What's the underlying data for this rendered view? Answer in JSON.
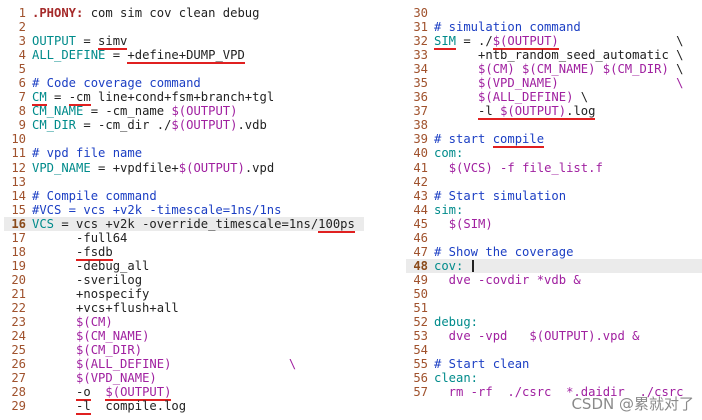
{
  "left_lines": [
    {
      "n": "1",
      "segs": [
        {
          "t": ".PHONY:",
          "c": "c-type"
        },
        {
          "t": " com sim cov clean debug",
          "c": "c-plain"
        }
      ]
    },
    {
      "n": "2",
      "segs": []
    },
    {
      "n": "3",
      "segs": [
        {
          "t": "OUTPUT",
          "c": "c-ident"
        },
        {
          "t": " = ",
          "c": "c-plain"
        },
        {
          "t": "simv",
          "c": "c-plain",
          "u": true
        }
      ]
    },
    {
      "n": "4",
      "segs": [
        {
          "t": "ALL_DEFINE",
          "c": "c-ident"
        },
        {
          "t": " = ",
          "c": "c-plain"
        },
        {
          "t": "+define+DUMP_VPD",
          "c": "c-plain",
          "u": true
        }
      ]
    },
    {
      "n": "5",
      "segs": []
    },
    {
      "n": "6",
      "segs": [
        {
          "t": "# Code coverage command",
          "c": "c-comment"
        }
      ]
    },
    {
      "n": "7",
      "segs": [
        {
          "t": "CM",
          "c": "c-ident",
          "u": true
        },
        {
          "t": " = ",
          "c": "c-plain"
        },
        {
          "t": "-cm",
          "c": "c-plain",
          "u": true
        },
        {
          "t": " line+cond+fsm+branch+tgl",
          "c": "c-plain"
        }
      ]
    },
    {
      "n": "8",
      "segs": [
        {
          "t": "CM_NAME",
          "c": "c-ident"
        },
        {
          "t": " = -cm_name ",
          "c": "c-plain"
        },
        {
          "t": "$(OUTPUT)",
          "c": "c-var"
        }
      ]
    },
    {
      "n": "9",
      "segs": [
        {
          "t": "CM_DIR",
          "c": "c-ident"
        },
        {
          "t": " = -cm_dir ./",
          "c": "c-plain"
        },
        {
          "t": "$(OUTPUT)",
          "c": "c-var"
        },
        {
          "t": ".vdb",
          "c": "c-plain"
        }
      ]
    },
    {
      "n": "10",
      "segs": []
    },
    {
      "n": "11",
      "segs": [
        {
          "t": "# vpd file name",
          "c": "c-comment"
        }
      ]
    },
    {
      "n": "12",
      "segs": [
        {
          "t": "VPD_NAME",
          "c": "c-ident"
        },
        {
          "t": " = +vpdfile+",
          "c": "c-plain"
        },
        {
          "t": "$(OUTPUT)",
          "c": "c-var"
        },
        {
          "t": ".vpd",
          "c": "c-plain"
        }
      ]
    },
    {
      "n": "13",
      "segs": []
    },
    {
      "n": "14",
      "segs": [
        {
          "t": "# Compile command",
          "c": "c-comment"
        }
      ]
    },
    {
      "n": "15",
      "segs": [
        {
          "t": "#VCS = vcs +v2k -timescale=1ns/1ns",
          "c": "c-comment"
        }
      ]
    },
    {
      "n": "16",
      "cur": true,
      "hl": true,
      "segs": [
        {
          "t": "VCS",
          "c": "c-ident"
        },
        {
          "t": " = vcs +v2k -override_timescale=1ns/",
          "c": "c-plain"
        },
        {
          "t": "100ps",
          "c": "c-plain",
          "u": true
        }
      ]
    },
    {
      "n": "17",
      "segs": [
        {
          "t": "      -full64",
          "c": "c-plain"
        }
      ]
    },
    {
      "n": "18",
      "segs": [
        {
          "t": "      ",
          "c": "c-plain"
        },
        {
          "t": "-fsdb",
          "c": "c-plain",
          "u": true
        }
      ]
    },
    {
      "n": "19",
      "segs": [
        {
          "t": "      -debug_all",
          "c": "c-plain"
        }
      ]
    },
    {
      "n": "20",
      "segs": [
        {
          "t": "      -sverilog",
          "c": "c-plain"
        }
      ]
    },
    {
      "n": "21",
      "segs": [
        {
          "t": "      +nospecify",
          "c": "c-plain"
        }
      ]
    },
    {
      "n": "22",
      "segs": [
        {
          "t": "      +vcs+flush+all",
          "c": "c-plain"
        }
      ]
    },
    {
      "n": "23",
      "segs": [
        {
          "t": "      ",
          "c": "c-plain"
        },
        {
          "t": "$(CM)",
          "c": "c-var"
        }
      ]
    },
    {
      "n": "24",
      "segs": [
        {
          "t": "      ",
          "c": "c-plain"
        },
        {
          "t": "$(CM_NAME)",
          "c": "c-var"
        }
      ]
    },
    {
      "n": "25",
      "segs": [
        {
          "t": "      ",
          "c": "c-plain"
        },
        {
          "t": "$(CM_DIR)",
          "c": "c-var"
        }
      ]
    },
    {
      "n": "26",
      "segs": [
        {
          "t": "      ",
          "c": "c-plain"
        },
        {
          "t": "$(ALL_DEFINE)",
          "c": "c-var"
        },
        {
          "t": "                \\",
          "c": "c-var"
        }
      ]
    },
    {
      "n": "27",
      "segs": [
        {
          "t": "      ",
          "c": "c-plain"
        },
        {
          "t": "$(VPD_NAME)",
          "c": "c-var"
        }
      ]
    },
    {
      "n": "28",
      "segs": [
        {
          "t": "      ",
          "c": "c-plain"
        },
        {
          "t": "-o",
          "c": "c-plain",
          "u": true
        },
        {
          "t": "  ",
          "c": "c-plain"
        },
        {
          "t": "$(OUTPUT)",
          "c": "c-var",
          "u": true
        }
      ]
    },
    {
      "n": "29",
      "segs": [
        {
          "t": "      ",
          "c": "c-plain"
        },
        {
          "t": "-l",
          "c": "c-plain",
          "u": true
        },
        {
          "t": "  compile.log",
          "c": "c-plain"
        }
      ]
    }
  ],
  "right_lines": [
    {
      "n": "30",
      "segs": []
    },
    {
      "n": "31",
      "segs": [
        {
          "t": "# simulation command",
          "c": "c-comment"
        }
      ]
    },
    {
      "n": "32",
      "segs": [
        {
          "t": "SIM",
          "c": "c-ident",
          "u": true
        },
        {
          "t": " = ./",
          "c": "c-plain"
        },
        {
          "t": "$(OUTPUT)",
          "c": "c-var",
          "u": true
        },
        {
          "t": "                \\",
          "c": "c-plain"
        }
      ]
    },
    {
      "n": "33",
      "segs": [
        {
          "t": "      +ntb_random_seed_automatic \\",
          "c": "c-plain"
        }
      ]
    },
    {
      "n": "34",
      "segs": [
        {
          "t": "      ",
          "c": "c-plain"
        },
        {
          "t": "$(CM) $(CM_NAME) $(CM_DIR)",
          "c": "c-var"
        },
        {
          "t": " \\",
          "c": "c-plain"
        }
      ]
    },
    {
      "n": "35",
      "segs": [
        {
          "t": "      ",
          "c": "c-plain"
        },
        {
          "t": "$(VPD_NAME)",
          "c": "c-var"
        },
        {
          "t": "                \\",
          "c": "c-var"
        }
      ]
    },
    {
      "n": "36",
      "segs": [
        {
          "t": "      ",
          "c": "c-plain"
        },
        {
          "t": "$(ALL_DEFINE)",
          "c": "c-var"
        },
        {
          "t": " \\",
          "c": "c-plain"
        }
      ]
    },
    {
      "n": "37",
      "segs": [
        {
          "t": "      ",
          "c": "c-plain"
        },
        {
          "t": "-l",
          "c": "c-plain",
          "u": true
        },
        {
          "t": " ",
          "c": "c-plain",
          "u": true
        },
        {
          "t": "$(OUTPUT)",
          "c": "c-var",
          "u": true
        },
        {
          "t": ".log",
          "c": "c-plain",
          "u": true
        }
      ]
    },
    {
      "n": "38",
      "segs": []
    },
    {
      "n": "39",
      "segs": [
        {
          "t": "# start ",
          "c": "c-comment"
        },
        {
          "t": "compile",
          "c": "c-comment",
          "u": true
        }
      ]
    },
    {
      "n": "40",
      "segs": [
        {
          "t": "com:",
          "c": "c-ident"
        }
      ]
    },
    {
      "n": "41",
      "segs": [
        {
          "t": "  ",
          "c": "c-plain"
        },
        {
          "t": "$(VCS)",
          "c": "c-var"
        },
        {
          "t": " -f file_list.f",
          "c": "c-var"
        }
      ]
    },
    {
      "n": "42",
      "segs": []
    },
    {
      "n": "43",
      "segs": [
        {
          "t": "# Start simulation",
          "c": "c-comment"
        }
      ]
    },
    {
      "n": "44",
      "segs": [
        {
          "t": "sim:",
          "c": "c-ident"
        }
      ]
    },
    {
      "n": "45",
      "segs": [
        {
          "t": "  ",
          "c": "c-plain"
        },
        {
          "t": "$(SIM)",
          "c": "c-var"
        }
      ]
    },
    {
      "n": "46",
      "segs": []
    },
    {
      "n": "47",
      "segs": [
        {
          "t": "# Show the coverage",
          "c": "c-comment"
        }
      ]
    },
    {
      "n": "48",
      "cur": true,
      "hl": true,
      "cursor": true,
      "segs": [
        {
          "t": "cov:",
          "c": "c-ident"
        },
        {
          "t": " ",
          "c": "c-plain"
        }
      ]
    },
    {
      "n": "49",
      "segs": [
        {
          "t": "  dve -covdir *vdb &",
          "c": "c-var"
        }
      ]
    },
    {
      "n": "50",
      "segs": []
    },
    {
      "n": "51",
      "segs": []
    },
    {
      "n": "52",
      "segs": [
        {
          "t": "debug:",
          "c": "c-ident"
        }
      ]
    },
    {
      "n": "53",
      "segs": [
        {
          "t": "  dve -vpd   ",
          "c": "c-var"
        },
        {
          "t": "$(OUTPUT)",
          "c": "c-var"
        },
        {
          "t": ".vpd &",
          "c": "c-var"
        }
      ]
    },
    {
      "n": "54",
      "segs": []
    },
    {
      "n": "55",
      "segs": [
        {
          "t": "# Start clean",
          "c": "c-comment"
        }
      ]
    },
    {
      "n": "56",
      "segs": [
        {
          "t": "clean:",
          "c": "c-ident"
        }
      ]
    },
    {
      "n": "57",
      "segs": [
        {
          "t": "  rm -rf  ./csrc  *.daidir  ./csrc   \\",
          "c": "c-var"
        }
      ]
    }
  ],
  "watermark": "CSDN @累就对了"
}
